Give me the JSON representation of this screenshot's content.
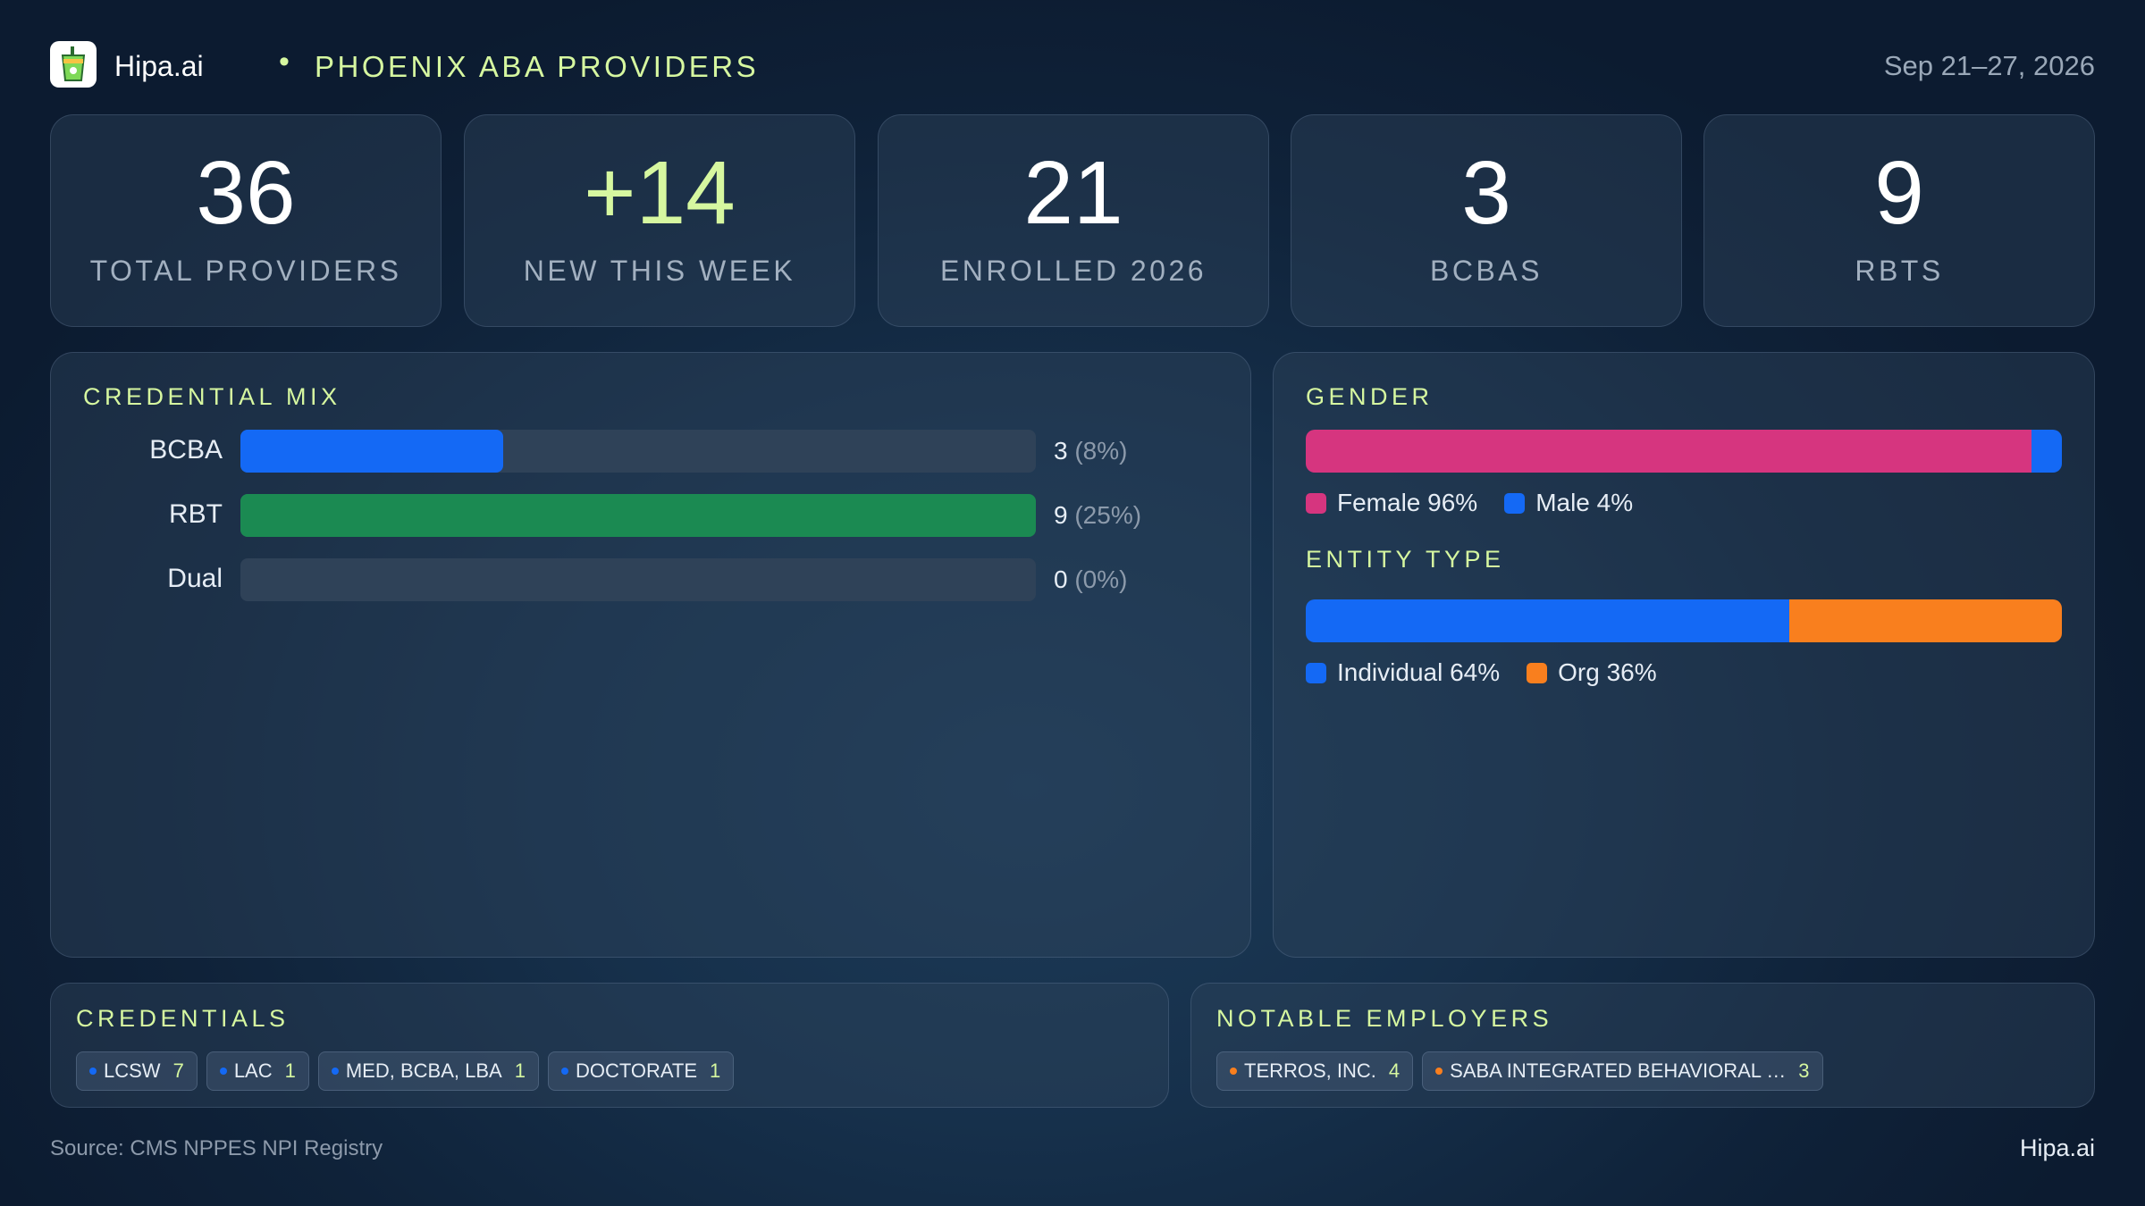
{
  "header": {
    "brand": "Hipa.ai",
    "separator": "•",
    "title": "PHOENIX ABA PROVIDERS",
    "date_range": "Sep 21–27, 2026",
    "logo_icon": "cup-icon"
  },
  "stats": [
    {
      "value": "36",
      "label": "TOTAL PROVIDERS"
    },
    {
      "value": "+14",
      "label": "NEW THIS WEEK"
    },
    {
      "value": "21",
      "label": "ENROLLED 2026"
    },
    {
      "value": "3",
      "label": "BCBAS"
    },
    {
      "value": "9",
      "label": "RBTS"
    }
  ],
  "credential_mix": {
    "title": "CREDENTIAL MIX",
    "rows": [
      {
        "label": "BCBA",
        "count": "3",
        "pct_text": "(8%)",
        "share": 0.33,
        "color": "#1469f5"
      },
      {
        "label": "RBT",
        "count": "9",
        "pct_text": "(25%)",
        "share": 1.0,
        "color": "#1b8a52"
      },
      {
        "label": "Dual",
        "count": "0",
        "pct_text": "(0%)",
        "share": 0.0,
        "color": "#1469f5"
      }
    ]
  },
  "gender": {
    "title": "GENDER",
    "segments": [
      {
        "label": "Female 96%",
        "percent": 96,
        "color": "#d6357f"
      },
      {
        "label": "Male 4%",
        "percent": 4,
        "color": "#1469f5"
      }
    ]
  },
  "entity_type": {
    "title": "ENTITY TYPE",
    "segments": [
      {
        "label": "Individual 64%",
        "percent": 64,
        "color": "#1469f5"
      },
      {
        "label": "Org 36%",
        "percent": 36,
        "color": "#f97f1e"
      }
    ]
  },
  "credentials": {
    "title": "CREDENTIALS",
    "dot_color": "#1469f5",
    "items": [
      {
        "label": "LCSW",
        "count": "7"
      },
      {
        "label": "LAC",
        "count": "1"
      },
      {
        "label": "MED, BCBA, LBA",
        "count": "1"
      },
      {
        "label": "DOCTORATE",
        "count": "1"
      }
    ]
  },
  "employers": {
    "title": "NOTABLE EMPLOYERS",
    "dot_color": "#f97f1e",
    "items": [
      {
        "label": "TERROS, INC.",
        "count": "4"
      },
      {
        "label": "SABA INTEGRATED BEHAVIORAL …",
        "count": "3"
      }
    ]
  },
  "footer": {
    "source": "Source: CMS NPPES NPI Registry",
    "brand": "Hipa.ai"
  }
}
